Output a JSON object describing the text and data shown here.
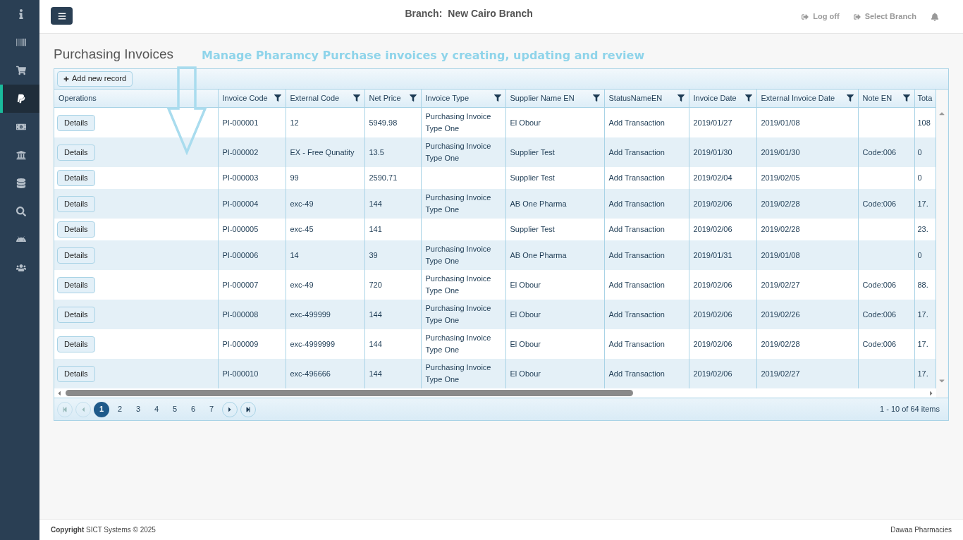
{
  "sidebar": {
    "items": [
      {
        "kind": "info",
        "selected": false
      },
      {
        "kind": "barcode",
        "selected": false
      },
      {
        "kind": "cart",
        "selected": false
      },
      {
        "kind": "paypal",
        "selected": true
      },
      {
        "kind": "money",
        "selected": false
      },
      {
        "kind": "bank",
        "selected": false
      },
      {
        "kind": "database",
        "selected": false
      },
      {
        "kind": "search",
        "selected": false
      },
      {
        "kind": "android",
        "selected": false
      },
      {
        "kind": "users",
        "selected": false
      }
    ]
  },
  "header": {
    "branch_label": "Branch:",
    "branch_name": "New Cairo Branch",
    "links": [
      "Log off",
      "Select Branch"
    ]
  },
  "page": {
    "title": "Purchasing Invoices",
    "annotation": "Manage Pharamcy Purchase invoices y creating, updating and review"
  },
  "grid": {
    "add_button": "Add new record",
    "columns": [
      {
        "label": "Operations",
        "kind": "action"
      },
      {
        "label": "Invoice Code",
        "filter": true
      },
      {
        "label": "External Code",
        "filter": true
      },
      {
        "label": "Net Price",
        "filter": true
      },
      {
        "label": "Invoice Type",
        "filter": true
      },
      {
        "label": "Supplier Name EN",
        "filter": true
      },
      {
        "label": "StatusNameEN",
        "filter": true
      },
      {
        "label": "Invoice Date",
        "filter": true
      },
      {
        "label": "External Invoice Date",
        "filter": true
      },
      {
        "label": "Note EN",
        "filter": true
      },
      {
        "label": "Tota",
        "filter": false
      }
    ],
    "rows": [
      {
        "cells": [
          "Details",
          "PI-000001",
          "12",
          "5949.98",
          "Purchasing Invoice Type One",
          "El Obour",
          "Add Transaction",
          "2019/01/27",
          "2019/01/08",
          "",
          "108"
        ]
      },
      {
        "cells": [
          "Details",
          "PI-000002",
          "EX - Free Qunatity",
          "13.5",
          "Purchasing Invoice Type One",
          "Supplier Test",
          "Add Transaction",
          "2019/01/30",
          "2019/01/30",
          "Code:006",
          "0"
        ]
      },
      {
        "cells": [
          "Details",
          "PI-000003",
          "99",
          "2590.71",
          "",
          "Supplier Test",
          "Add Transaction",
          "2019/02/04",
          "2019/02/05",
          "",
          "0"
        ]
      },
      {
        "cells": [
          "Details",
          "PI-000004",
          "exc-49",
          "144",
          "Purchasing Invoice Type One",
          "AB One Pharma",
          "Add Transaction",
          "2019/02/06",
          "2019/02/28",
          "Code:006",
          "17."
        ]
      },
      {
        "cells": [
          "Details",
          "PI-000005",
          "exc-45",
          "141",
          "",
          "Supplier Test",
          "Add Transaction",
          "2019/02/06",
          "2019/02/28",
          "",
          "23."
        ]
      },
      {
        "cells": [
          "Details",
          "PI-000006",
          "14",
          "39",
          "Purchasing Invoice Type One",
          "AB One Pharma",
          "Add Transaction",
          "2019/01/31",
          "2019/01/08",
          "",
          "0"
        ]
      },
      {
        "cells": [
          "Details",
          "PI-000007",
          "exc-49",
          "720",
          "Purchasing Invoice Type One",
          "El Obour",
          "Add Transaction",
          "2019/02/06",
          "2019/02/27",
          "Code:006",
          "88."
        ]
      },
      {
        "cells": [
          "Details",
          "PI-000008",
          "exc-499999",
          "144",
          "Purchasing Invoice Type One",
          "El Obour",
          "Add Transaction",
          "2019/02/06",
          "2019/02/26",
          "Code:006",
          "17."
        ]
      },
      {
        "cells": [
          "Details",
          "PI-000009",
          "exc-4999999",
          "144",
          "Purchasing Invoice Type One",
          "El Obour",
          "Add Transaction",
          "2019/02/06",
          "2019/02/28",
          "Code:006",
          "17."
        ]
      },
      {
        "cells": [
          "Details",
          "PI-000010",
          "exc-496666",
          "144",
          "Purchasing Invoice Type One",
          "El Obour",
          "Add Transaction",
          "2019/02/06",
          "2019/02/27",
          "",
          "17."
        ]
      }
    ],
    "pager": {
      "pages": [
        {
          "label": "1",
          "selected": true
        },
        {
          "label": "2",
          "selected": false
        },
        {
          "label": "3",
          "selected": false
        },
        {
          "label": "4",
          "selected": false
        },
        {
          "label": "5",
          "selected": false
        },
        {
          "label": "6",
          "selected": false
        },
        {
          "label": "7",
          "selected": false
        }
      ],
      "summary": "1 - 10 of 64 items"
    }
  },
  "footer": {
    "copyright": "**Copyright** SICT Systems © 2025",
    "brand": "Dawaa Pharmacies"
  }
}
